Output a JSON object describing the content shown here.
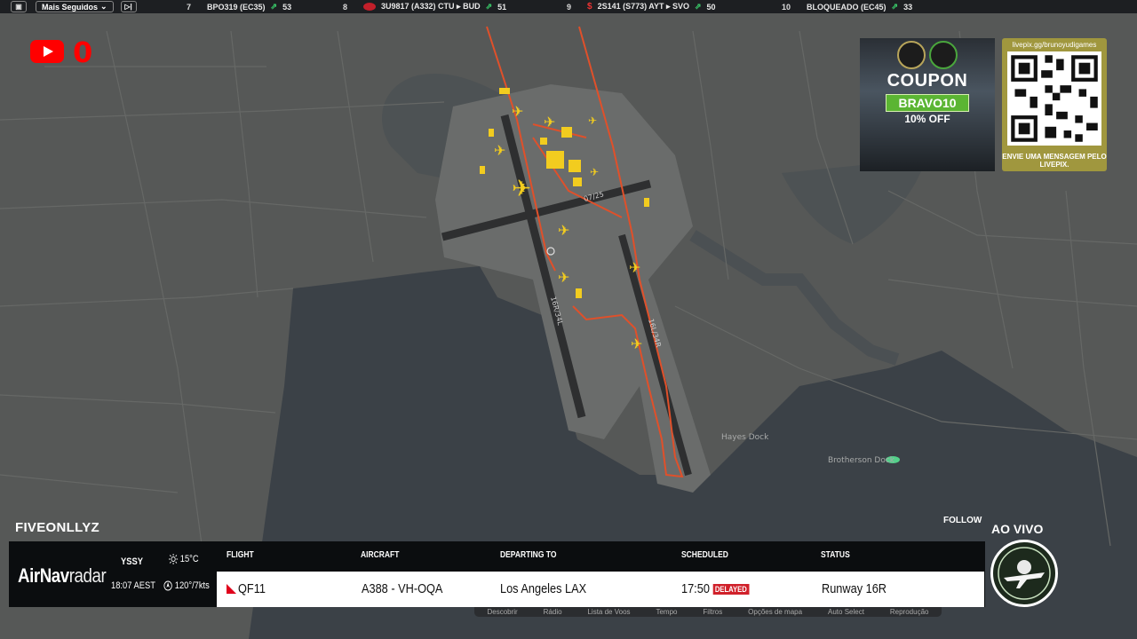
{
  "topbar": {
    "menu_icon": "window-icon",
    "filter_label": "Mais Seguidos",
    "next_icon": "skip-icon",
    "items": [
      {
        "rank": "7",
        "flight": "BPO319 (EC35)",
        "count": "53"
      },
      {
        "rank": "8",
        "flight": "3U9817 (A332) CTU ▸ BUD",
        "count": "51"
      },
      {
        "rank": "9",
        "flight": "2S141 (S773) AYT ▸ SVO",
        "count": "50"
      },
      {
        "rank": "10",
        "flight": "BLOQUEADO (EC45)",
        "count": "33"
      }
    ]
  },
  "overlay": {
    "youtube_count": "0",
    "coupon": {
      "title": "COUPON",
      "code": "BRAVO10",
      "discount": "10% OFF"
    },
    "livepix": {
      "url": "livepix.gg/brunoyudigames",
      "message": "ENVIE UMA MENSAGEM PELO LIVEPIX."
    },
    "live_label": "AO VIVO"
  },
  "map": {
    "labels": [
      "07/25",
      "16R/34L",
      "16L/34R",
      "Hayes Dock",
      "Brotherson Dock"
    ],
    "water_color": "#3b4147",
    "land_color": "#555756",
    "route_color": "#e0502a",
    "aircraft_color": "#f2cc1f"
  },
  "panel": {
    "username": "FIVEONLLYZ",
    "follow_label": "FOLLOW",
    "brand": "AirNav",
    "brand_suffix": "radar",
    "airport_code": "YSSY",
    "local_time": "18:07 AEST",
    "temperature": "15°C",
    "wind": "120°/7kts",
    "headers": {
      "flight": "FLIGHT",
      "aircraft": "AIRCRAFT",
      "destination": "DEPARTING TO",
      "scheduled": "SCHEDULED",
      "status": "STATUS"
    },
    "flight": {
      "number": "QF11",
      "aircraft": "A388 - VH-OQA",
      "destination": "Los Angeles LAX",
      "scheduled": "17:50",
      "delayed_label": "DELAYED",
      "status": "Runway 16R"
    },
    "menu": [
      "Descobrir",
      "Rádio",
      "Lista de Voos",
      "Tempo",
      "Filtros",
      "Opções de mapa",
      "Auto Select",
      "Reprodução"
    ]
  }
}
